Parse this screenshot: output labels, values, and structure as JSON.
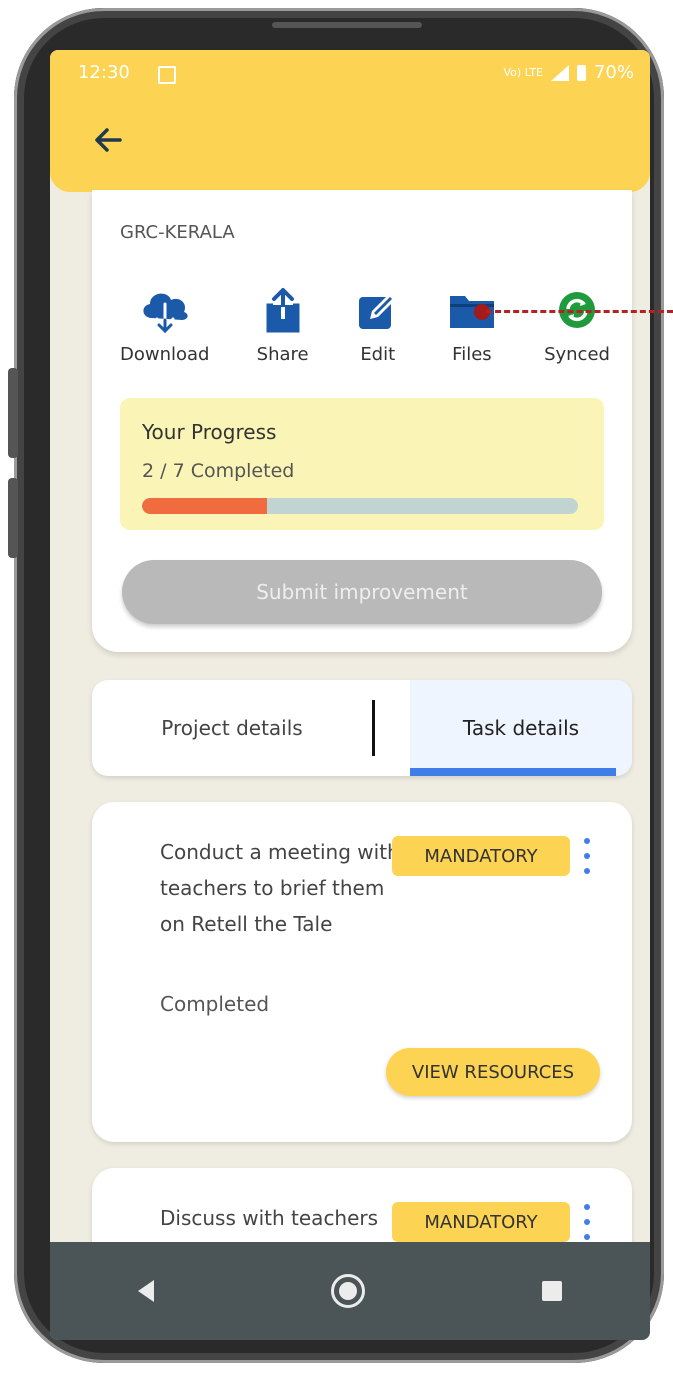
{
  "status_bar": {
    "time": "12:30",
    "carrier": "Vo) LTE",
    "battery": "70%"
  },
  "header": {
    "org_name": "GRC-KERALA"
  },
  "actions": [
    {
      "label": "Download",
      "icon": "cloud-download-icon"
    },
    {
      "label": "Share",
      "icon": "share-icon"
    },
    {
      "label": "Edit",
      "icon": "edit-icon"
    },
    {
      "label": "Files",
      "icon": "folder-icon"
    },
    {
      "label": "Synced",
      "icon": "sync-icon"
    }
  ],
  "progress": {
    "title": "Your Progress",
    "summary": "2 / 7 Completed",
    "completed": 2,
    "total": 7,
    "fraction": 0.2857
  },
  "submit_label": "Submit improvement",
  "tabs": {
    "project": "Project details",
    "task": "Task details",
    "active": "task"
  },
  "tasks": [
    {
      "title": "Conduct a meeting with teachers to brief them on Retell the Tale",
      "badge": "MANDATORY",
      "status": "Completed",
      "action": "VIEW RESOURCES"
    },
    {
      "title": "Discuss with teachers",
      "badge": "MANDATORY"
    }
  ],
  "colors": {
    "header": "#fcd352",
    "icon_blue": "#1a5aa8",
    "sync_green": "#1f9a3c",
    "progress_fill": "#f06b3e",
    "tab_underline": "#3f7ee8"
  }
}
